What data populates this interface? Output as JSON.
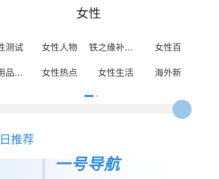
{
  "header": {
    "title": "女性"
  },
  "categories": [
    {
      "label": "性测试"
    },
    {
      "label": "女性人物"
    },
    {
      "label": "铁之缘补..."
    },
    {
      "label": "女性百"
    },
    {
      "label": "用品..."
    },
    {
      "label": "女性热点"
    },
    {
      "label": "女性生活"
    },
    {
      "label": "海外新"
    }
  ],
  "carousel": {
    "page_count": 2,
    "active_page": 1
  },
  "section": {
    "title": "日推荐"
  },
  "watermark": {
    "text": "一号导航"
  },
  "colors": {
    "accent": "#2f8fe0",
    "section_title": "#2f86d6",
    "divider": "#f3f3f3",
    "text": "#333333"
  }
}
